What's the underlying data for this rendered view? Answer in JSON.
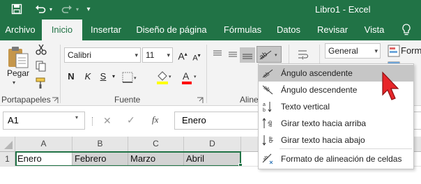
{
  "window": {
    "title": "Libro1 - Excel"
  },
  "qat": {
    "save_icon": "save-icon",
    "undo_icon": "undo-icon",
    "redo_icon": "redo-icon",
    "customize_icon": "customize-qat-icon"
  },
  "tabs": [
    "Archivo",
    "Inicio",
    "Insertar",
    "Diseño de página",
    "Fórmulas",
    "Datos",
    "Revisar",
    "Vista"
  ],
  "tell_me_icon": "lightbulb-icon",
  "ribbon": {
    "clipboard": {
      "paste_label": "Pegar",
      "group_label": "Portapapeles"
    },
    "font": {
      "font_name": "Calibri",
      "font_size": "11",
      "grow_label": "A",
      "shrink_label": "A",
      "bold": "N",
      "italic": "K",
      "underline": "S",
      "font_color_label": "A",
      "group_label": "Fuente",
      "highlight_color": "#ffff00",
      "font_color": "#ff0000"
    },
    "alignment": {
      "group_label": "Aline"
    },
    "number": {
      "format": "General",
      "styles_partial": "Form"
    }
  },
  "formula_bar": {
    "name_box": "A1",
    "fx_label": "fx",
    "content": "Enero"
  },
  "sheet": {
    "columns": [
      "A",
      "B",
      "C",
      "D"
    ],
    "rows": [
      "1"
    ],
    "cells": [
      "Enero",
      "Febrero",
      "Marzo",
      "Abril"
    ]
  },
  "orientation_menu": {
    "items": [
      {
        "label": "Ángulo ascendente",
        "icon": "angle-counterclockwise-icon"
      },
      {
        "label": "Ángulo descendente",
        "icon": "angle-clockwise-icon"
      },
      {
        "label": "Texto vertical",
        "icon": "vertical-text-icon"
      },
      {
        "label": "Girar texto hacia arriba",
        "icon": "rotate-text-up-icon"
      },
      {
        "label": "Girar texto hacia abajo",
        "icon": "rotate-text-down-icon"
      },
      {
        "label": "Formato de alineación de celdas",
        "icon": "format-cell-alignment-icon"
      }
    ]
  },
  "colors": {
    "excel_green": "#217346",
    "pointer": "#e8262a"
  }
}
